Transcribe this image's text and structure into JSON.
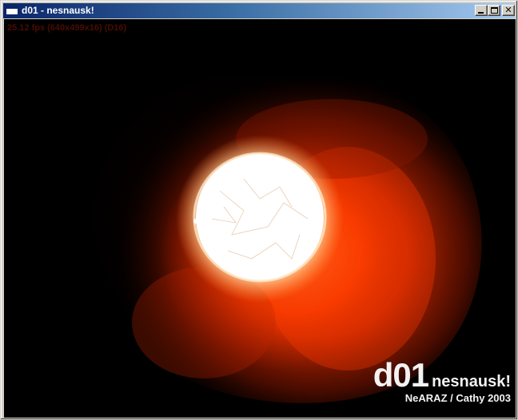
{
  "window": {
    "title": "d01 - nesnausk!",
    "controls": {
      "minimize_icon": "minimize-icon",
      "maximize_icon": "maximize-icon",
      "close_icon": "close-icon",
      "close_glyph": "✕"
    }
  },
  "render": {
    "fps_text": "25.12 fps (640x499x16) (D16)",
    "logo_big": "d01",
    "logo_small": "nesnausk!",
    "credit": "NeARAZ / Cathy 2003"
  },
  "colors": {
    "titlebar_start": "#0a246a",
    "titlebar_end": "#a6caf0",
    "smoke_core": "#ff3a00",
    "sun_core": "#ffffff",
    "background": "#000000"
  }
}
